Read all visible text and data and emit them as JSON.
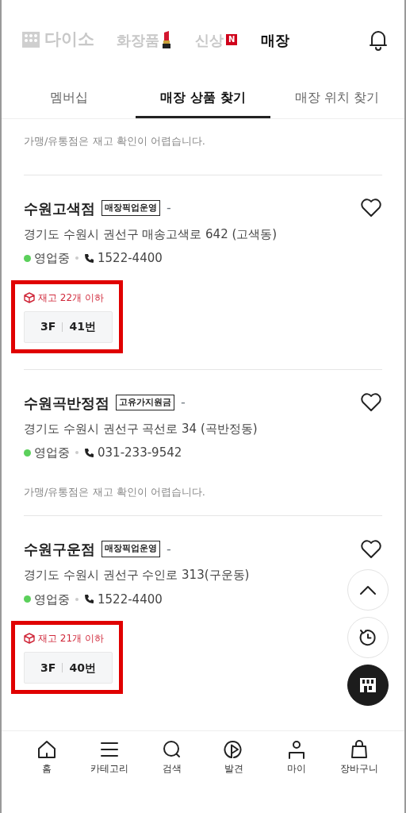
{
  "header": {
    "logo": "다이소",
    "menu": [
      {
        "label": "화장품",
        "kind": "lipstick",
        "selected": false
      },
      {
        "label": "신상",
        "kind": "new",
        "badge": "N",
        "selected": false
      },
      {
        "label": "매장",
        "selected": true
      }
    ]
  },
  "tabs": [
    {
      "label": "멤버십",
      "selected": false
    },
    {
      "label": "매장 상품 찾기",
      "selected": true
    },
    {
      "label": "매장 위치 찾기",
      "selected": false
    }
  ],
  "top_note": "가맹/유통점은 재고 확인이 어렵습니다.",
  "stores": [
    {
      "name": "수원고색점",
      "tag": "매장픽업운영",
      "suffix": "-",
      "address": "경기도 수원시 권선구 매송고색로 642 (고색동)",
      "status": "영업중",
      "open": true,
      "phone": "1522-4400",
      "stock": "재고 22개 이하",
      "floor": "3F",
      "spot": "41번",
      "highlighted": true,
      "favorite": false
    },
    {
      "name": "수원곡반정점",
      "tag": "고유가지원금",
      "suffix": "-",
      "address": "경기도 수원시 권선구 곡선로 34 (곡반정동)",
      "status": "영업중",
      "open": true,
      "phone": "031-233-9542",
      "note": "가맹/유통점은 재고 확인이 어렵습니다.",
      "favorite": false
    },
    {
      "name": "수원구운점",
      "tag": "매장픽업운영",
      "suffix": "-",
      "address": "경기도 수원시 권선구 수인로 313(구운동)",
      "status": "영업중",
      "open": true,
      "phone": "1522-4400",
      "stock": "재고 21개 이하",
      "floor": "3F",
      "spot": "40번",
      "highlighted": true,
      "favorite": false
    }
  ],
  "bottom_nav": [
    {
      "label": "홈",
      "kind": "home"
    },
    {
      "label": "카테고리",
      "kind": "menu"
    },
    {
      "label": "검색",
      "kind": "search"
    },
    {
      "label": "발견",
      "kind": "play"
    },
    {
      "label": "마이",
      "kind": "user"
    },
    {
      "label": "장바구니",
      "kind": "bag"
    }
  ]
}
